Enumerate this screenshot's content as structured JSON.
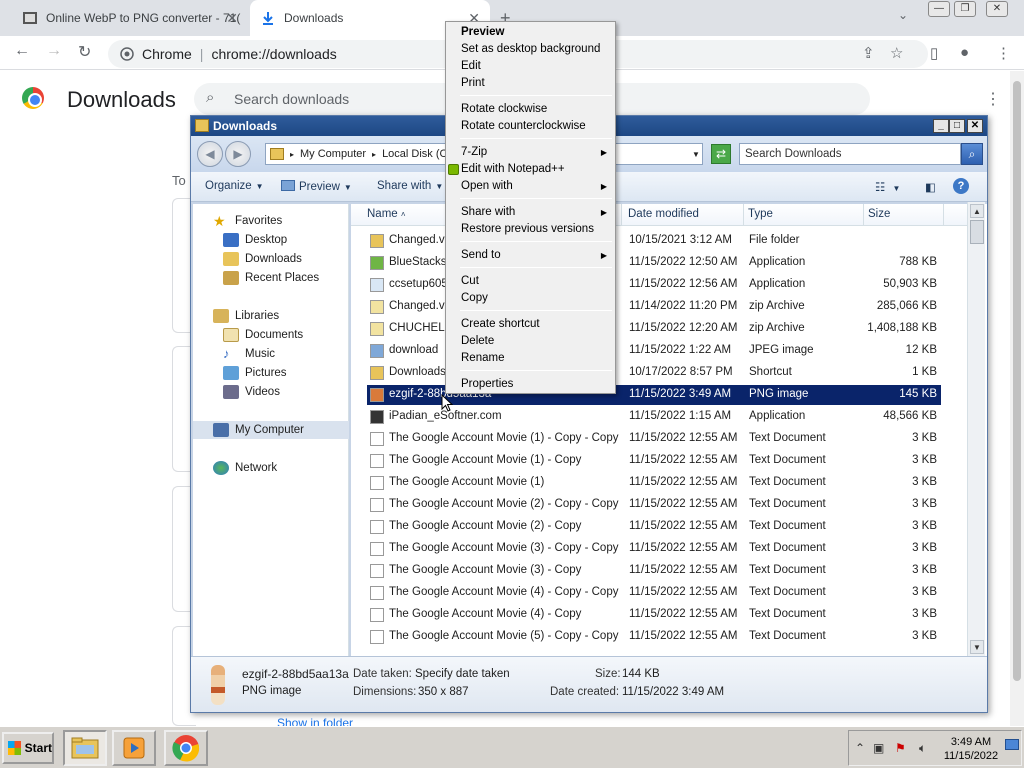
{
  "browser": {
    "tabs": [
      {
        "title": "Online WebP to PNG converter - 71(",
        "close": "✕"
      },
      {
        "title": "Downloads",
        "close": "✕"
      }
    ],
    "new_tab": "+",
    "omnibox": {
      "site": "Chrome",
      "url": "chrome://downloads"
    }
  },
  "downloads_page": {
    "title": "Downloads",
    "search_placeholder": "Search downloads",
    "section_label": "To",
    "show_in_folder": "Show in folder"
  },
  "explorer": {
    "title": "Downloads",
    "breadcrumb": [
      "My Computer",
      "Local Disk (C"
    ],
    "search_placeholder": "Search Downloads",
    "commands": {
      "organize": "Organize",
      "preview": "Preview",
      "share_with": "Share with"
    },
    "nav": {
      "favorites": "Favorites",
      "desktop": "Desktop",
      "downloads": "Downloads",
      "recent_places": "Recent Places",
      "libraries": "Libraries",
      "documents": "Documents",
      "music": "Music",
      "pictures": "Pictures",
      "videos": "Videos",
      "my_computer": "My Computer",
      "network": "Network"
    },
    "columns": {
      "name": "Name",
      "date_modified": "Date modified",
      "type": "Type",
      "size": "Size"
    },
    "files": [
      {
        "name": "Changed.v",
        "date": "10/15/2021 3:12 AM",
        "type": "File folder",
        "size": "",
        "icon": "folder-icon"
      },
      {
        "name": "BlueStacksI",
        "date": "11/15/2022 12:50 AM",
        "type": "Application",
        "size": "788 KB",
        "icon": "bluestacks-icon"
      },
      {
        "name": "ccsetup605",
        "date": "11/15/2022 12:56 AM",
        "type": "Application",
        "size": "50,903 KB",
        "icon": "ccleaner-icon"
      },
      {
        "name": "Changed.v",
        "date": "11/14/2022 11:20 PM",
        "type": "zip Archive",
        "size": "285,066 KB",
        "icon": "zip-icon"
      },
      {
        "name": "CHUCHEL.v",
        "date": "11/15/2022 12:20 AM",
        "type": "zip Archive",
        "size": "1,408,188 KB",
        "icon": "zip-icon"
      },
      {
        "name": "download",
        "date": "11/15/2022 1:22 AM",
        "type": "JPEG image",
        "size": "12 KB",
        "icon": "image-icon"
      },
      {
        "name": "Downloads",
        "date": "10/17/2022 8:57 PM",
        "type": "Shortcut",
        "size": "1 KB",
        "icon": "shortcut-icon"
      },
      {
        "name": "ezgif-2-88bd5aa13a",
        "date": "11/15/2022 3:49 AM",
        "type": "PNG image",
        "size": "145 KB",
        "icon": "png-icon"
      },
      {
        "name": "iPadian_eSoftner.com",
        "date": "11/15/2022 1:15 AM",
        "type": "Application",
        "size": "48,566 KB",
        "icon": "ipadian-icon"
      },
      {
        "name": "The Google Account Movie (1) - Copy - Copy",
        "date": "11/15/2022 12:55 AM",
        "type": "Text Document",
        "size": "3 KB",
        "icon": "text-document-icon"
      },
      {
        "name": "The Google Account Movie (1) - Copy",
        "date": "11/15/2022 12:55 AM",
        "type": "Text Document",
        "size": "3 KB",
        "icon": "text-document-icon"
      },
      {
        "name": "The Google Account Movie (1)",
        "date": "11/15/2022 12:55 AM",
        "type": "Text Document",
        "size": "3 KB",
        "icon": "text-document-icon"
      },
      {
        "name": "The Google Account Movie (2) - Copy - Copy",
        "date": "11/15/2022 12:55 AM",
        "type": "Text Document",
        "size": "3 KB",
        "icon": "text-document-icon"
      },
      {
        "name": "The Google Account Movie (2) - Copy",
        "date": "11/15/2022 12:55 AM",
        "type": "Text Document",
        "size": "3 KB",
        "icon": "text-document-icon"
      },
      {
        "name": "The Google Account Movie (3) - Copy - Copy",
        "date": "11/15/2022 12:55 AM",
        "type": "Text Document",
        "size": "3 KB",
        "icon": "text-document-icon"
      },
      {
        "name": "The Google Account Movie (3) - Copy",
        "date": "11/15/2022 12:55 AM",
        "type": "Text Document",
        "size": "3 KB",
        "icon": "text-document-icon"
      },
      {
        "name": "The Google Account Movie (4) - Copy - Copy",
        "date": "11/15/2022 12:55 AM",
        "type": "Text Document",
        "size": "3 KB",
        "icon": "text-document-icon"
      },
      {
        "name": "The Google Account Movie (4) - Copy",
        "date": "11/15/2022 12:55 AM",
        "type": "Text Document",
        "size": "3 KB",
        "icon": "text-document-icon"
      },
      {
        "name": "The Google Account Movie (5) - Copy - Copy",
        "date": "11/15/2022 12:55 AM",
        "type": "Text Document",
        "size": "3 KB",
        "icon": "text-document-icon"
      }
    ],
    "selected_file": "ezgif-2-88bd5aa13a",
    "details": {
      "name": "ezgif-2-88bd5aa13a",
      "type": "PNG image",
      "date_taken_label": "Date taken:",
      "date_taken": "Specify date taken",
      "dimensions_label": "Dimensions:",
      "dimensions": "350 x 887",
      "size_label": "Size:",
      "size": "144 KB",
      "date_created_label": "Date created:",
      "date_created": "11/15/2022 3:49 AM"
    }
  },
  "context_menu": {
    "items": [
      {
        "label": "Preview",
        "bold": true
      },
      {
        "label": "Set as desktop background"
      },
      {
        "label": "Edit"
      },
      {
        "label": "Print"
      },
      {
        "label": "Rotate clockwise"
      },
      {
        "label": "Rotate counterclockwise"
      },
      {
        "label": "7-Zip",
        "submenu": true
      },
      {
        "label": "Edit with Notepad++"
      },
      {
        "label": "Open with",
        "submenu": true
      },
      {
        "label": "Share with",
        "submenu": true
      },
      {
        "label": "Restore previous versions"
      },
      {
        "label": "Send to",
        "submenu": true
      },
      {
        "label": "Cut"
      },
      {
        "label": "Copy"
      },
      {
        "label": "Create shortcut"
      },
      {
        "label": "Delete"
      },
      {
        "label": "Rename"
      },
      {
        "label": "Properties"
      }
    ]
  },
  "taskbar": {
    "start": "Start",
    "clock_time": "3:49 AM",
    "clock_date": "11/15/2022"
  }
}
